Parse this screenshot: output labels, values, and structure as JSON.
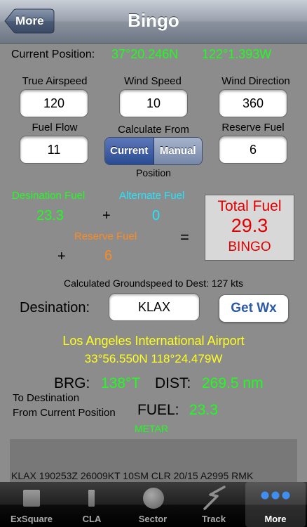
{
  "nav": {
    "back_label": "More",
    "title": "Bingo"
  },
  "position": {
    "label": "Current Position:",
    "lat": "37°20.246N",
    "lon": "122°1.393W"
  },
  "inputs": {
    "true_airspeed": {
      "label": "True Airspeed",
      "value": "120"
    },
    "wind_speed": {
      "label": "Wind Speed",
      "value": "10"
    },
    "wind_direction": {
      "label": "Wind Direction",
      "value": "360"
    },
    "fuel_flow": {
      "label": "Fuel Flow",
      "value": "11"
    },
    "reserve_fuel": {
      "label": "Reserve Fuel",
      "value": "6"
    }
  },
  "calc_from": {
    "label": "Calculate From",
    "options": [
      "Current",
      "Manual"
    ],
    "selected": "Current",
    "sublabel": "Position"
  },
  "fuel": {
    "dest_label": "Desination Fuel",
    "dest_value": "23.3",
    "alt_label": "Alternate Fuel",
    "alt_value": "0",
    "res_label": "Reserve Fuel",
    "res_value": "6",
    "plus": "+",
    "equals": "="
  },
  "total": {
    "label": "Total Fuel",
    "value": "29.3",
    "status": "BINGO"
  },
  "groundspeed": "Calculated Groundspeed to Dest: 127 kts",
  "destination": {
    "label": "Desination:",
    "value": "KLAX",
    "button": "Get Wx"
  },
  "airport": {
    "name": "Los Angeles International Airport",
    "coords": "33°56.550N  118°24.479W"
  },
  "route": {
    "brg_label": "BRG:",
    "brg_value": "138°T",
    "dist_label": "DIST:",
    "dist_value": "269.5 nm",
    "to_dest_line1": "To Destination",
    "to_dest_line2": "From Current Position",
    "fuel_label": "FUEL:",
    "fuel_value": "23.3"
  },
  "metar": {
    "label": "METAR",
    "text": "KLAX 190253Z 26009KT 10SM CLR 20/15 A2995 RMK"
  },
  "tabs": [
    {
      "label": "ExSquare",
      "icon": "square-icon"
    },
    {
      "label": "CLA",
      "icon": "bar-icon"
    },
    {
      "label": "Sector",
      "icon": "circle-icon"
    },
    {
      "label": "Track",
      "icon": "track-icon"
    },
    {
      "label": "More",
      "icon": "more-dots-icon"
    }
  ],
  "selected_tab": "More"
}
